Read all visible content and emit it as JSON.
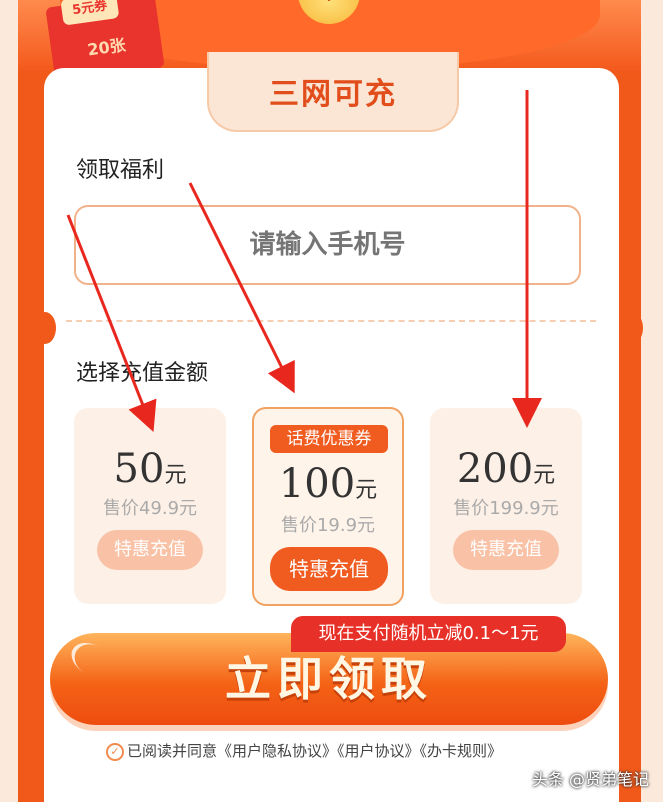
{
  "header": {
    "coupon_pill": "5元券",
    "coupon_count": "20张",
    "coin_symbol": "¥"
  },
  "card": {
    "title": "三网可充",
    "welfare_label": "领取福利",
    "phone_placeholder": "请输入手机号",
    "amount_label": "选择充值金额"
  },
  "options": [
    {
      "amount": "50",
      "unit": "元",
      "price": "售价49.9元",
      "button": "特惠充值",
      "selected": false
    },
    {
      "amount": "100",
      "unit": "元",
      "price": "售价19.9元",
      "button": "特惠充值",
      "badge": "话费优惠券",
      "selected": true
    },
    {
      "amount": "200",
      "unit": "元",
      "price": "售价199.9元",
      "button": "特惠充值",
      "selected": false
    }
  ],
  "promo": "现在支付随机立减0.1～1元",
  "cta": "立即领取",
  "agreement": "已阅读并同意《用户隐私协议》《用户协议》《办卡规则》",
  "watermark": "头条 @贤弟笔记",
  "colors": {
    "accent": "#f05b1f",
    "background": "#f1591a",
    "promo": "#e73027",
    "arrow": "#e8281e"
  }
}
